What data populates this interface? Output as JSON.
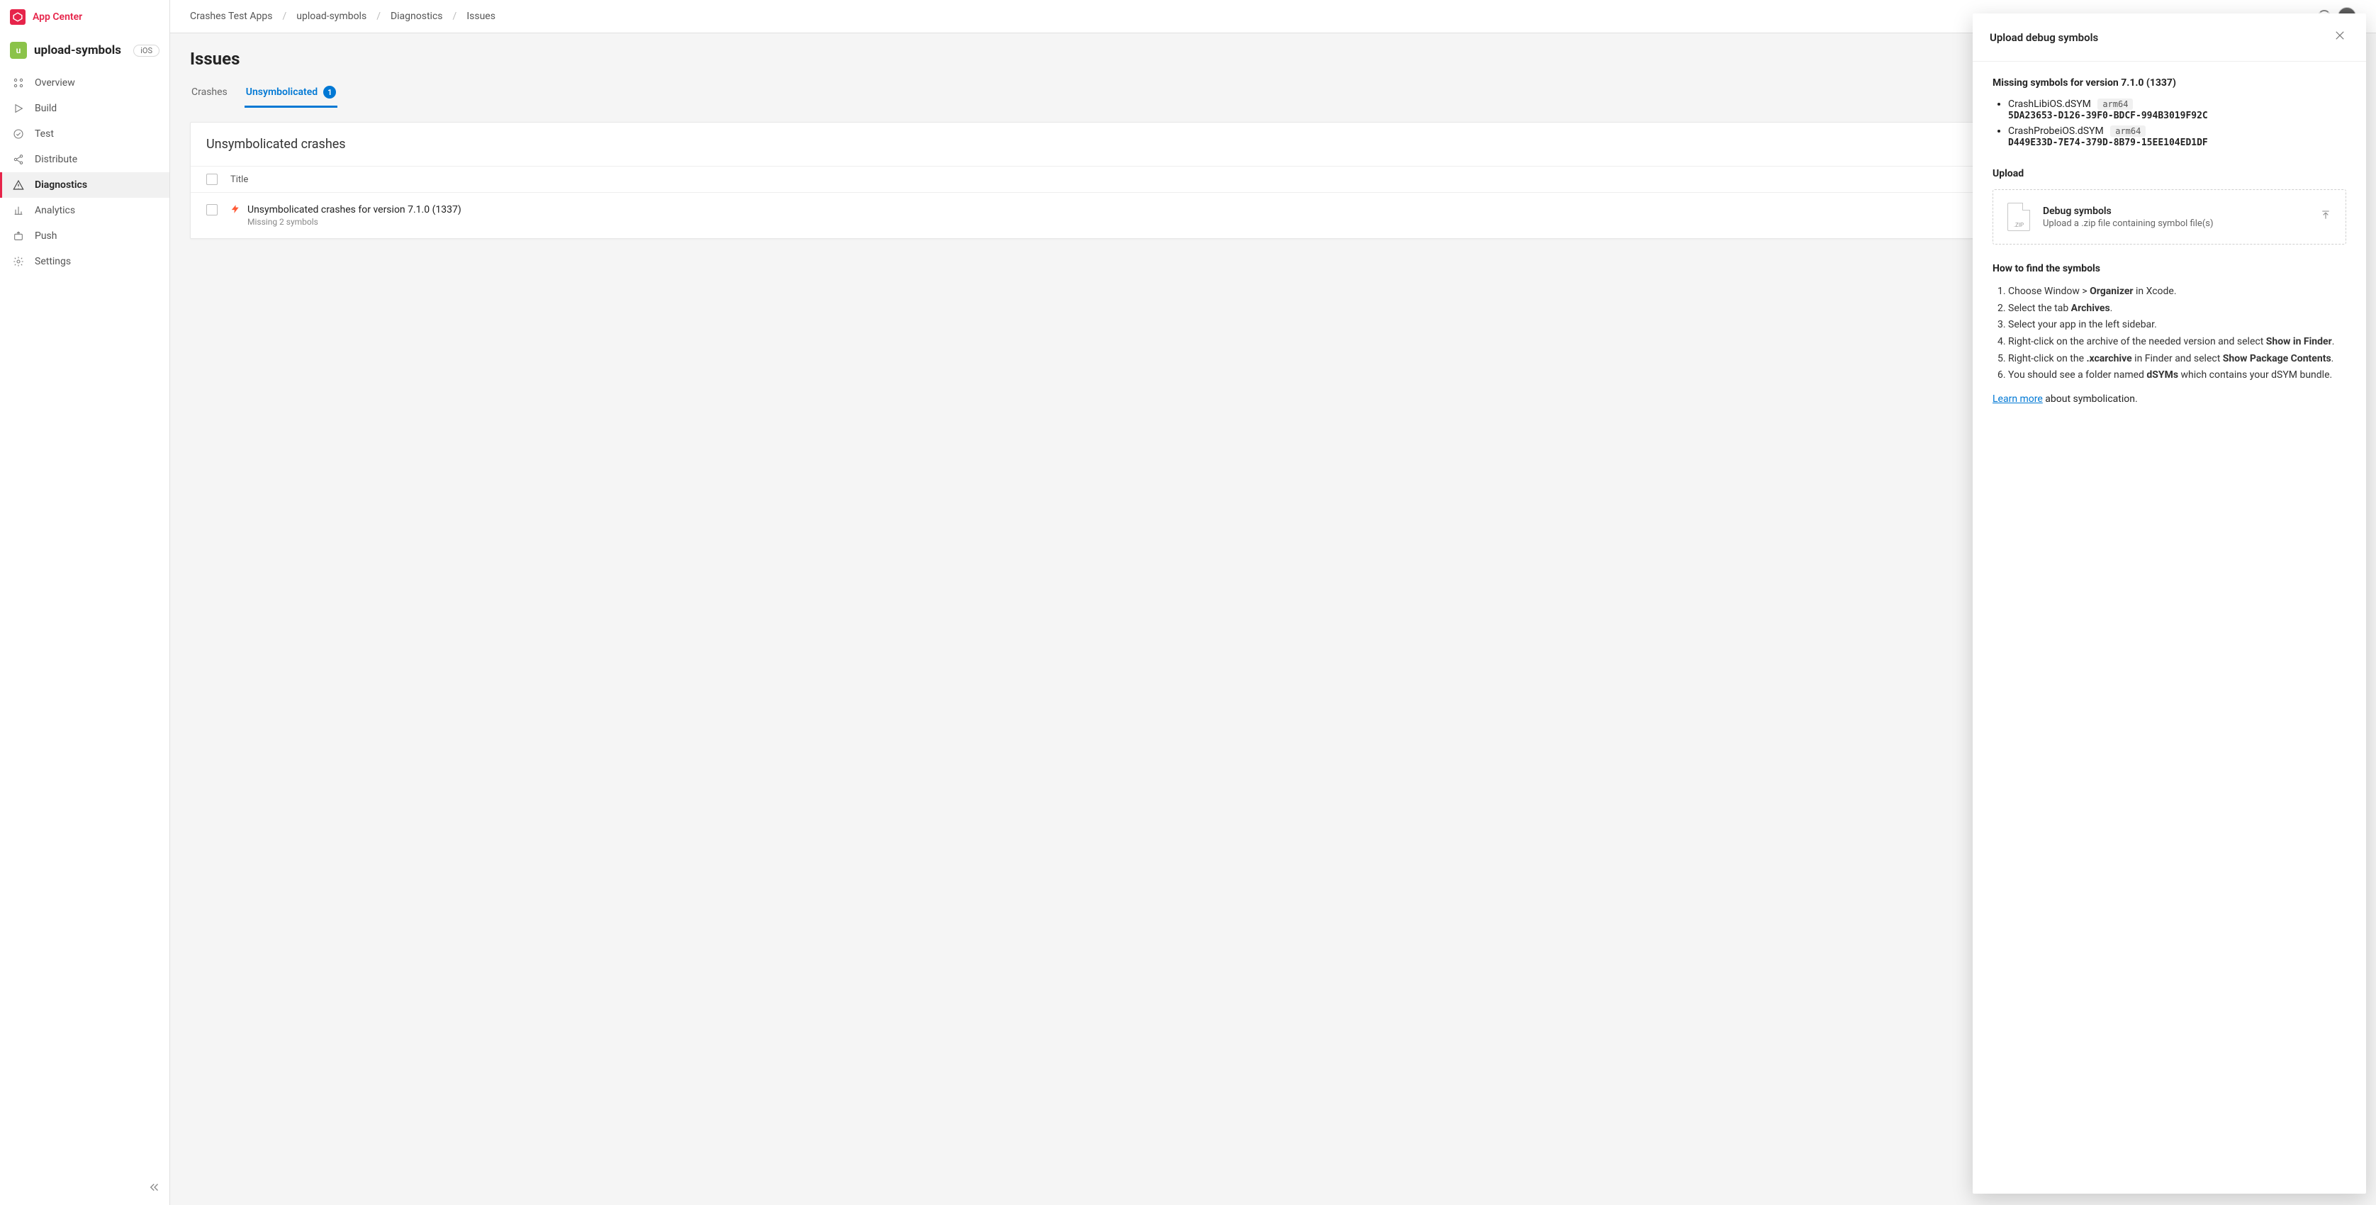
{
  "brand": {
    "name": "App Center"
  },
  "appHeader": {
    "avatarLetter": "u",
    "name": "upload-symbols",
    "platform": "iOS"
  },
  "nav": {
    "items": [
      {
        "label": "Overview",
        "icon": "grid"
      },
      {
        "label": "Build",
        "icon": "play"
      },
      {
        "label": "Test",
        "icon": "check"
      },
      {
        "label": "Distribute",
        "icon": "share"
      },
      {
        "label": "Diagnostics",
        "icon": "warning",
        "active": true
      },
      {
        "label": "Analytics",
        "icon": "chart"
      },
      {
        "label": "Push",
        "icon": "push"
      },
      {
        "label": "Settings",
        "icon": "gear"
      }
    ]
  },
  "breadcrumbs": [
    "Crashes Test Apps",
    "upload-symbols",
    "Diagnostics",
    "Issues"
  ],
  "page": {
    "title": "Issues"
  },
  "tabs": {
    "items": [
      {
        "label": "Crashes"
      },
      {
        "label": "Unsymbolicated",
        "active": true,
        "count": "1"
      }
    ]
  },
  "card": {
    "title": "Unsymbolicated crashes",
    "columnHeader": "Title",
    "rows": [
      {
        "title": "Unsymbolicated crashes for version 7.1.0 (1337)",
        "subtitle": "Missing 2 symbols"
      }
    ]
  },
  "panel": {
    "title": "Upload debug symbols",
    "missingTitle": "Missing symbols for version 7.1.0 (1337)",
    "symbols": [
      {
        "name": "CrashLibiOS.dSYM",
        "arch": "arm64",
        "uuid": "5DA23653-D126-39F0-BDCF-994B3019F92C"
      },
      {
        "name": "CrashProbeiOS.dSYM",
        "arch": "arm64",
        "uuid": "D449E33D-7E74-379D-8B79-15EE104ED1DF"
      }
    ],
    "uploadHeading": "Upload",
    "upload": {
      "zipLabel": ".ZIP",
      "title": "Debug symbols",
      "subtitle": "Upload a .zip file containing symbol file(s)"
    },
    "howtoTitle": "How to find the symbols",
    "steps": {
      "s1a": "Choose Window > ",
      "s1b": "Organizer",
      "s1c": " in Xcode.",
      "s2a": "Select the tab ",
      "s2b": "Archives",
      "s2c": ".",
      "s3": "Select your app in the left sidebar.",
      "s4a": "Right-click on the archive of the needed version and select ",
      "s4b": "Show in Finder",
      "s4c": ".",
      "s5a": "Right-click on the ",
      "s5b": ".xcarchive",
      "s5c": " in Finder and select ",
      "s5d": "Show Package Contents",
      "s5e": ".",
      "s6a": "You should see a folder named ",
      "s6b": "dSYMs",
      "s6c": " which contains your dSYM bundle."
    },
    "learnLink": "Learn more",
    "learnRest": " about symbolication."
  }
}
